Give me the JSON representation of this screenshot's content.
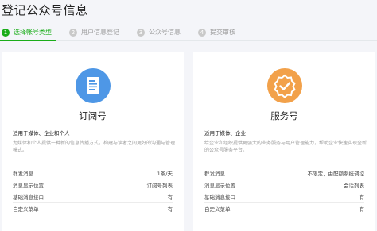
{
  "title": "登记公众号信息",
  "steps": [
    {
      "num": "1",
      "label": "选择帐号类型"
    },
    {
      "num": "2",
      "label": "用户信息登记"
    },
    {
      "num": "3",
      "label": "公众号信息"
    },
    {
      "num": "4",
      "label": "提交审核"
    }
  ],
  "cards": [
    {
      "name": "订阅号",
      "suit": "适用于媒体、企业和个人",
      "desc": "为媒体和个人提供一种新的信息传播方式，构建与读者之间更好的沟通与管理模式。",
      "features": [
        {
          "label": "群发消息",
          "value": "1条/天"
        },
        {
          "label": "消息显示位置",
          "value": "订阅号列表"
        },
        {
          "label": "基础消息接口",
          "value": "有"
        },
        {
          "label": "自定义菜单",
          "value": "有"
        }
      ]
    },
    {
      "name": "服务号",
      "suit": "适用于媒体、企业",
      "desc": "给企业和组织提供更强大的业务服务与用户管理能力，帮助企业快速实现全新的公众号服务平台。",
      "features": [
        {
          "label": "群发消息",
          "value": "不限定，由配额系统调控"
        },
        {
          "label": "消息显示位置",
          "value": "会话列表"
        },
        {
          "label": "基础消息接口",
          "value": "有"
        },
        {
          "label": "自定义菜单",
          "value": "有"
        }
      ]
    }
  ],
  "icons": {
    "subscription": "document-icon",
    "service": "verified-badge-icon"
  },
  "colors": {
    "accent": "#1aad19",
    "subscription_icon_bg": "#4e97e6",
    "service_icon_bg": "#f2a14a"
  }
}
